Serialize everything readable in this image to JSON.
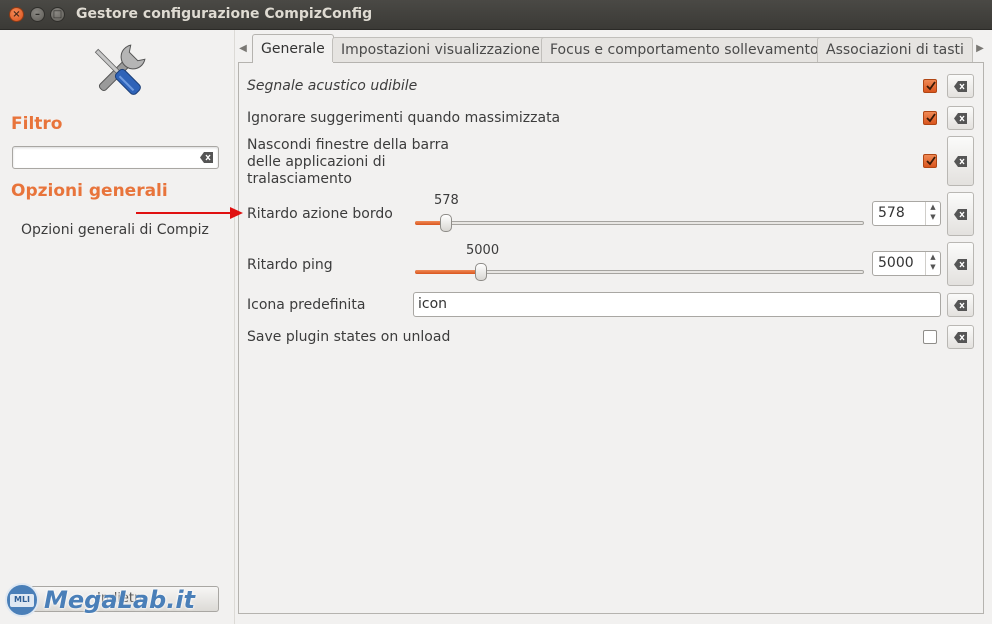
{
  "window": {
    "title": "Gestore configurazione CompizConfig",
    "close_glyph": "×",
    "min_glyph": "–",
    "max_glyph": "□"
  },
  "sidebar": {
    "filter_heading": "Filtro",
    "filter_value": "",
    "options_heading": "Opzioni generali",
    "category_item": "Opzioni generali di Compiz",
    "bottom_button_label": "Indietro"
  },
  "tabs": [
    {
      "label": "Generale",
      "active": true
    },
    {
      "label": "Impostazioni visualizzazione",
      "active": false
    },
    {
      "label": "Focus e comportamento sollevamento",
      "active": false
    },
    {
      "label": "Associazioni di tasti",
      "active": false
    }
  ],
  "tab_scroll": {
    "left": "◀",
    "right": "▶"
  },
  "settings": {
    "audible_bell": {
      "label": "Segnale acustico udibile",
      "checked": true
    },
    "ignore_hints": {
      "label": "Ignorare suggerimenti quando massimizzata",
      "checked": true
    },
    "hide_skip_taskbar": {
      "label_line1": "Nascondi finestre della barra",
      "label_line2": "delle applicazioni di",
      "label_line3": "tralasciamento",
      "checked": true
    },
    "edge_delay": {
      "label": "Ritardo azione bordo",
      "value": "578",
      "slider_fraction": 0.07
    },
    "ping_delay": {
      "label": "Ritardo ping",
      "value": "5000",
      "slider_fraction": 0.15
    },
    "default_icon": {
      "label": "Icona predefinita",
      "value": "icon"
    },
    "save_plugin_states": {
      "label": "Save plugin states on unload",
      "checked": false
    }
  },
  "spin_arrows": {
    "up": "▲",
    "down": "▼"
  },
  "watermark": {
    "text": "MegaLab.it",
    "badge": "MLI"
  },
  "colors": {
    "accent": "#e8743b",
    "checkbox_on": "#e0622a",
    "annotation_arrow": "#e01010",
    "titlebar": "#3c3b37"
  }
}
